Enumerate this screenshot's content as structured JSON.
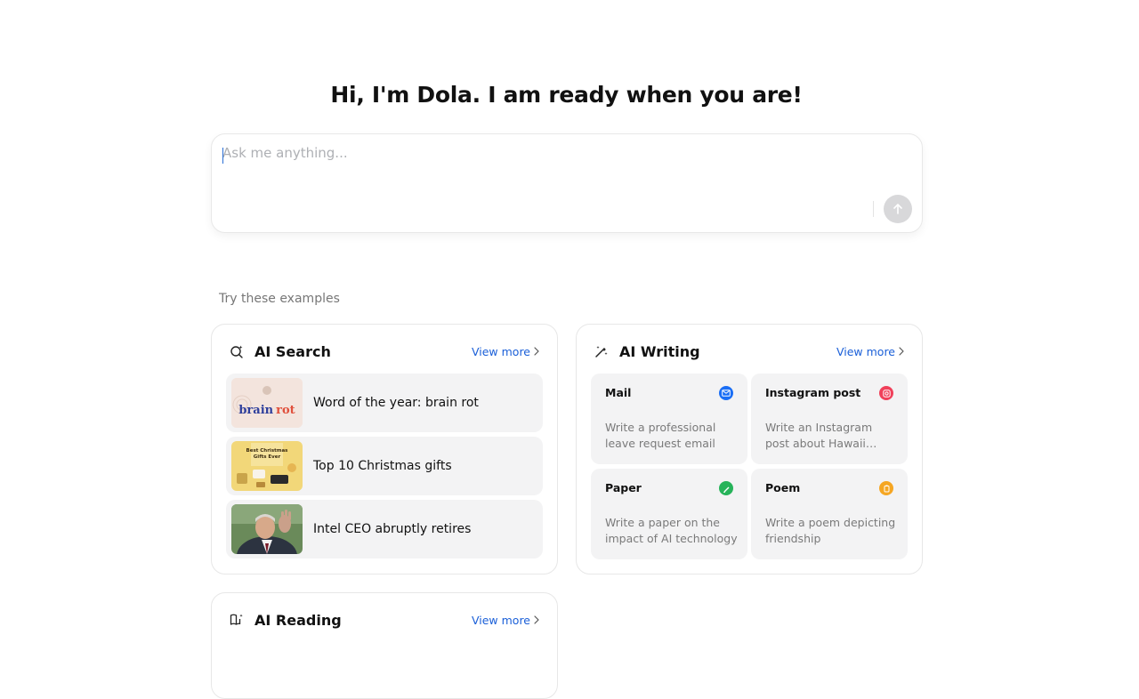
{
  "greeting": "Hi, I'm Dola. I am ready when you are!",
  "chat": {
    "placeholder": "Ask me anything..."
  },
  "examples_label": "Try these examples",
  "ai_search": {
    "title": "AI Search",
    "view_more": "View more",
    "items": [
      {
        "title": "Word of the year: brain rot",
        "thumb_text": "brain rot"
      },
      {
        "title": "Top 10 Christmas gifts",
        "thumb_text": "Best Christmas Gifts Ever"
      },
      {
        "title": "Intel CEO abruptly retires"
      }
    ]
  },
  "ai_writing": {
    "title": "AI Writing",
    "view_more": "View more",
    "items": [
      {
        "title": "Mail",
        "desc": "Write a professional leave request email",
        "icon": "mail-icon",
        "color": "#1a6ef5"
      },
      {
        "title": "Instagram post",
        "desc": "Write an Instagram post about Hawaii…",
        "icon": "instagram-icon",
        "color": "#f0405a"
      },
      {
        "title": "Paper",
        "desc": "Write a paper on the impact of AI technology",
        "icon": "pen-icon",
        "color": "#27b35a"
      },
      {
        "title": "Poem",
        "desc": "Write a poem depicting friendship",
        "icon": "poem-icon",
        "color": "#f5a623"
      }
    ]
  },
  "ai_reading": {
    "title": "AI Reading",
    "view_more": "View more"
  },
  "colors": {
    "accent": "#1a5fd8",
    "tile_bg": "#f3f3f4",
    "send_disabled": "#d8d8da"
  }
}
